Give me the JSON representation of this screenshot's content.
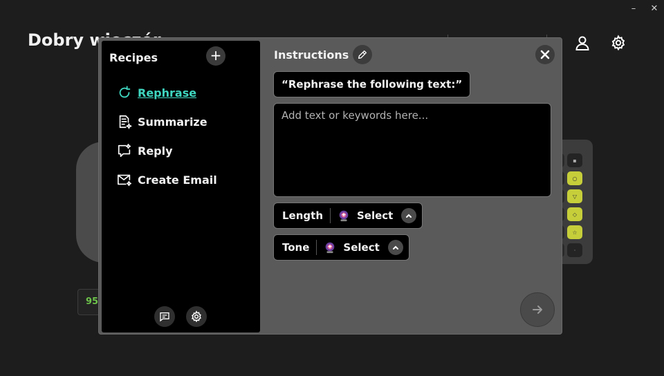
{
  "window": {
    "minimize_label": "–",
    "close_label": "✕"
  },
  "background": {
    "greeting": "Dobry wieczór",
    "battery": "95",
    "icons": [
      "devices-icon",
      "lighting-icon",
      "profile-icon",
      "settings-icon"
    ]
  },
  "dialog": {
    "recipes_title": "Recipes",
    "add_label": "+",
    "recipes": [
      {
        "label": "Rephrase",
        "icon": "rephrase-icon",
        "active": true
      },
      {
        "label": "Summarize",
        "icon": "summarize-icon",
        "active": false
      },
      {
        "label": "Reply",
        "icon": "reply-icon",
        "active": false
      },
      {
        "label": "Create Email",
        "icon": "create-email-icon",
        "active": false
      }
    ],
    "instructions_title": "Instructions",
    "prompt": "“Rephrase the following text:”",
    "input_placeholder": "Add text or keywords here...",
    "input_value": "",
    "length": {
      "label": "Length",
      "value": "Select"
    },
    "tone": {
      "label": "Tone",
      "value": "Select"
    }
  },
  "colors": {
    "accent": "#3fd6c0",
    "panel": "#5a5a5a",
    "background": "#1d1d1d"
  }
}
